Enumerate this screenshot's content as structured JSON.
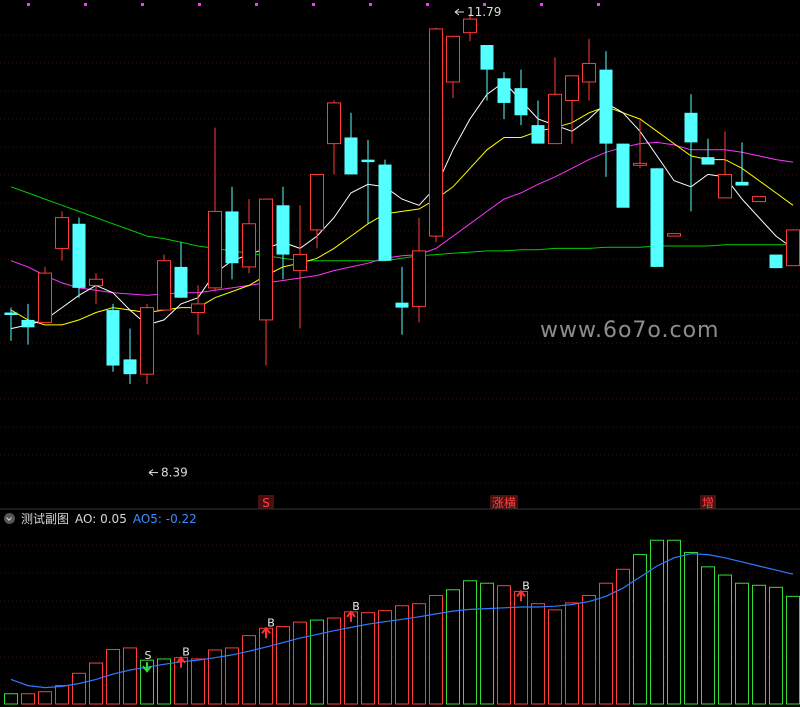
{
  "indicator": {
    "name": "测试副图",
    "ao_label": "AO: 0.05",
    "ao5_label": "AO5: -0.22"
  },
  "watermark": "www.6o7o.com",
  "colors": {
    "up": "#ff3b3b",
    "down": "#54ffff",
    "ma5": "#ffffff",
    "ma10": "#ffff00",
    "ma20": "#ff33ff",
    "ma60": "#00cc00",
    "ao_up": "#ff3b3b",
    "ao_down": "#33dd33",
    "ao5_line": "#2f7bff",
    "grid": "#3a1010"
  },
  "chart_data": [
    {
      "type": "candlestick",
      "x": [
        1,
        2,
        3,
        4,
        5,
        6,
        7,
        8,
        9,
        10,
        11,
        12,
        13,
        14,
        15,
        16,
        17,
        18,
        19,
        20,
        21,
        22,
        23,
        24,
        25,
        26,
        27,
        28,
        29,
        30,
        31,
        32,
        33,
        34,
        35,
        36,
        37,
        38,
        39,
        40,
        41,
        42,
        43,
        44,
        45,
        46,
        47
      ],
      "ohlc": [
        [
          9.68,
          9.72,
          9.45,
          9.66
        ],
        [
          9.62,
          9.75,
          9.42,
          9.56
        ],
        [
          9.6,
          10.05,
          9.6,
          10.0
        ],
        [
          10.2,
          10.5,
          10.1,
          10.45
        ],
        [
          10.4,
          10.45,
          9.8,
          9.88
        ],
        [
          9.9,
          10.0,
          9.75,
          9.95
        ],
        [
          9.7,
          9.75,
          9.2,
          9.25
        ],
        [
          9.3,
          9.55,
          9.1,
          9.18
        ],
        [
          9.18,
          9.75,
          9.1,
          9.72
        ],
        [
          9.7,
          10.15,
          9.7,
          10.1
        ],
        [
          10.05,
          10.25,
          9.8,
          9.8
        ],
        [
          9.68,
          9.9,
          9.5,
          9.75
        ],
        [
          9.88,
          11.18,
          9.85,
          10.5
        ],
        [
          10.5,
          10.7,
          9.95,
          10.08
        ],
        [
          10.05,
          10.6,
          10.0,
          10.4
        ],
        [
          9.62,
          10.45,
          9.25,
          10.6
        ],
        [
          10.55,
          10.7,
          9.95,
          10.15
        ],
        [
          10.02,
          10.55,
          9.55,
          10.15
        ],
        [
          10.35,
          10.75,
          10.2,
          10.8
        ],
        [
          11.05,
          11.4,
          10.8,
          11.38
        ],
        [
          11.1,
          11.3,
          10.8,
          10.8
        ],
        [
          10.92,
          11.08,
          10.4,
          10.9
        ],
        [
          10.88,
          10.92,
          10.2,
          10.1
        ],
        [
          9.76,
          10.05,
          9.5,
          9.72
        ],
        [
          9.73,
          10.45,
          9.6,
          10.18
        ],
        [
          10.3,
          11.99,
          10.25,
          11.98
        ],
        [
          11.55,
          11.79,
          11.42,
          11.92
        ],
        [
          11.95,
          12.1,
          11.88,
          12.06
        ],
        [
          11.85,
          11.85,
          11.4,
          11.65
        ],
        [
          11.58,
          11.63,
          11.25,
          11.38
        ],
        [
          11.5,
          11.65,
          11.2,
          11.28
        ],
        [
          11.2,
          11.4,
          11.05,
          11.05
        ],
        [
          11.05,
          11.75,
          11.05,
          11.45
        ],
        [
          11.4,
          11.48,
          11.05,
          11.6
        ],
        [
          11.55,
          11.9,
          11.4,
          11.7
        ],
        [
          11.65,
          11.8,
          10.78,
          11.05
        ],
        [
          11.05,
          11.05,
          10.66,
          10.53
        ],
        [
          10.88,
          11.24,
          10.85,
          10.89
        ],
        [
          10.85,
          10.85,
          10.42,
          10.05
        ],
        [
          10.3,
          10.38,
          10.38,
          10.32
        ],
        [
          11.3,
          11.45,
          10.5,
          11.06
        ],
        [
          10.94,
          11.09,
          10.89,
          10.88
        ],
        [
          10.61,
          11.15,
          10.78,
          10.8
        ],
        [
          10.74,
          11.06,
          10.72,
          10.71
        ],
        [
          10.58,
          10.58,
          10.58,
          10.62
        ],
        [
          10.15,
          10.15,
          10.15,
          10.04
        ],
        [
          10.06,
          10.06,
          10.06,
          10.35
        ]
      ],
      "ma5": [
        9.55,
        9.58,
        9.62,
        9.72,
        9.82,
        9.9,
        9.84,
        9.7,
        9.58,
        9.62,
        9.75,
        9.8,
        10.0,
        10.1,
        10.15,
        10.2,
        10.25,
        10.2,
        10.3,
        10.45,
        10.65,
        10.72,
        10.7,
        10.6,
        10.55,
        10.7,
        11.0,
        11.25,
        11.45,
        11.55,
        11.4,
        11.25,
        11.2,
        11.15,
        11.25,
        11.38,
        11.3,
        11.15,
        10.95,
        10.75,
        10.7,
        10.8,
        10.78,
        10.6,
        10.45,
        10.3,
        10.2
      ],
      "ma10": [
        9.7,
        9.62,
        9.58,
        9.58,
        9.62,
        9.68,
        9.72,
        9.7,
        9.68,
        9.7,
        9.72,
        9.72,
        9.8,
        9.85,
        9.9,
        9.98,
        10.05,
        10.08,
        10.12,
        10.2,
        10.3,
        10.4,
        10.48,
        10.5,
        10.52,
        10.6,
        10.7,
        10.85,
        11.0,
        11.1,
        11.1,
        11.15,
        11.18,
        11.22,
        11.3,
        11.35,
        11.3,
        11.25,
        11.15,
        11.05,
        10.95,
        10.92,
        10.92,
        10.85,
        10.75,
        10.65,
        10.55
      ],
      "ma20": [
        10.1,
        10.05,
        9.98,
        9.92,
        9.88,
        9.86,
        9.84,
        9.83,
        9.82,
        9.83,
        9.84,
        9.84,
        9.86,
        9.88,
        9.9,
        9.92,
        9.94,
        9.96,
        9.98,
        10.02,
        10.05,
        10.08,
        10.12,
        10.14,
        10.15,
        10.2,
        10.3,
        10.4,
        10.5,
        10.6,
        10.65,
        10.72,
        10.78,
        10.85,
        10.92,
        10.98,
        11.02,
        11.05,
        11.06,
        11.04,
        11.0,
        11.0,
        11.0,
        10.98,
        10.95,
        10.92,
        10.9
      ],
      "ma60": [
        10.7,
        10.65,
        10.6,
        10.55,
        10.5,
        10.45,
        10.4,
        10.35,
        10.3,
        10.28,
        10.25,
        10.22,
        10.2,
        10.18,
        10.16,
        10.14,
        10.12,
        10.1,
        10.1,
        10.1,
        10.1,
        10.1,
        10.1,
        10.12,
        10.14,
        10.15,
        10.16,
        10.17,
        10.18,
        10.18,
        10.19,
        10.19,
        10.2,
        10.2,
        10.2,
        10.21,
        10.21,
        10.21,
        10.22,
        10.22,
        10.22,
        10.22,
        10.23,
        10.23,
        10.23,
        10.23,
        10.23
      ],
      "ylim": [
        8.2,
        12.15
      ],
      "annotations": [
        {
          "text": "11.79",
          "x": 27,
          "y": 11.79
        },
        {
          "text": "8.39",
          "x": 9,
          "y": 8.39
        }
      ],
      "signals": [
        {
          "text": "S",
          "x": 16
        },
        {
          "text": "涨横",
          "x": 30
        },
        {
          "text": "增",
          "x": 42
        }
      ]
    },
    {
      "type": "bar",
      "x": [
        1,
        2,
        3,
        4,
        5,
        6,
        7,
        8,
        9,
        10,
        11,
        12,
        13,
        14,
        15,
        16,
        17,
        18,
        19,
        20,
        21,
        22,
        23,
        24,
        25,
        26,
        27,
        28,
        29,
        30,
        31,
        32,
        33,
        34,
        35,
        36,
        37,
        38,
        39,
        40,
        41,
        42,
        43,
        44,
        45,
        46,
        47
      ],
      "values": [
        -1.8,
        -1.8,
        -1.75,
        -1.6,
        -1.3,
        -1.05,
        -0.72,
        -0.68,
        -0.98,
        -0.95,
        -0.92,
        -0.95,
        -0.73,
        -0.68,
        -0.38,
        -0.2,
        -0.16,
        -0.05,
        0.0,
        0.05,
        0.2,
        0.18,
        0.23,
        0.35,
        0.4,
        0.6,
        0.74,
        0.96,
        0.9,
        0.84,
        0.7,
        0.4,
        0.25,
        0.42,
        0.6,
        0.9,
        1.24,
        1.6,
        1.95,
        1.95,
        1.65,
        1.3,
        1.1,
        0.9,
        0.85,
        0.8,
        0.58
      ],
      "colors": [
        "down",
        "up",
        "up",
        "up",
        "up",
        "up",
        "up",
        "up",
        "down",
        "down",
        "up",
        "up",
        "up",
        "up",
        "up",
        "up",
        "up",
        "up",
        "down",
        "up",
        "up",
        "up",
        "up",
        "up",
        "up",
        "up",
        "down",
        "down",
        "down",
        "up",
        "up",
        "up",
        "up",
        "up",
        "up",
        "up",
        "up",
        "down",
        "down",
        "down",
        "down",
        "down",
        "down",
        "down",
        "down",
        "down",
        "down"
      ],
      "ao5": [
        -1.45,
        -1.6,
        -1.65,
        -1.62,
        -1.55,
        -1.45,
        -1.32,
        -1.22,
        -1.15,
        -1.08,
        -1.02,
        -0.98,
        -0.92,
        -0.85,
        -0.76,
        -0.66,
        -0.55,
        -0.44,
        -0.35,
        -0.26,
        -0.18,
        -0.1,
        -0.04,
        0.02,
        0.08,
        0.15,
        0.22,
        0.26,
        0.28,
        0.3,
        0.32,
        0.32,
        0.34,
        0.38,
        0.45,
        0.58,
        0.78,
        1.05,
        1.32,
        1.52,
        1.62,
        1.6,
        1.52,
        1.42,
        1.32,
        1.22,
        1.12
      ],
      "ylim": [
        -2.05,
        2.2
      ],
      "signals": [
        {
          "text": "S",
          "x": 9
        },
        {
          "text": "B",
          "x": 11
        },
        {
          "text": "B",
          "x": 16
        },
        {
          "text": "B",
          "x": 21
        },
        {
          "text": "B",
          "x": 31
        }
      ]
    }
  ]
}
